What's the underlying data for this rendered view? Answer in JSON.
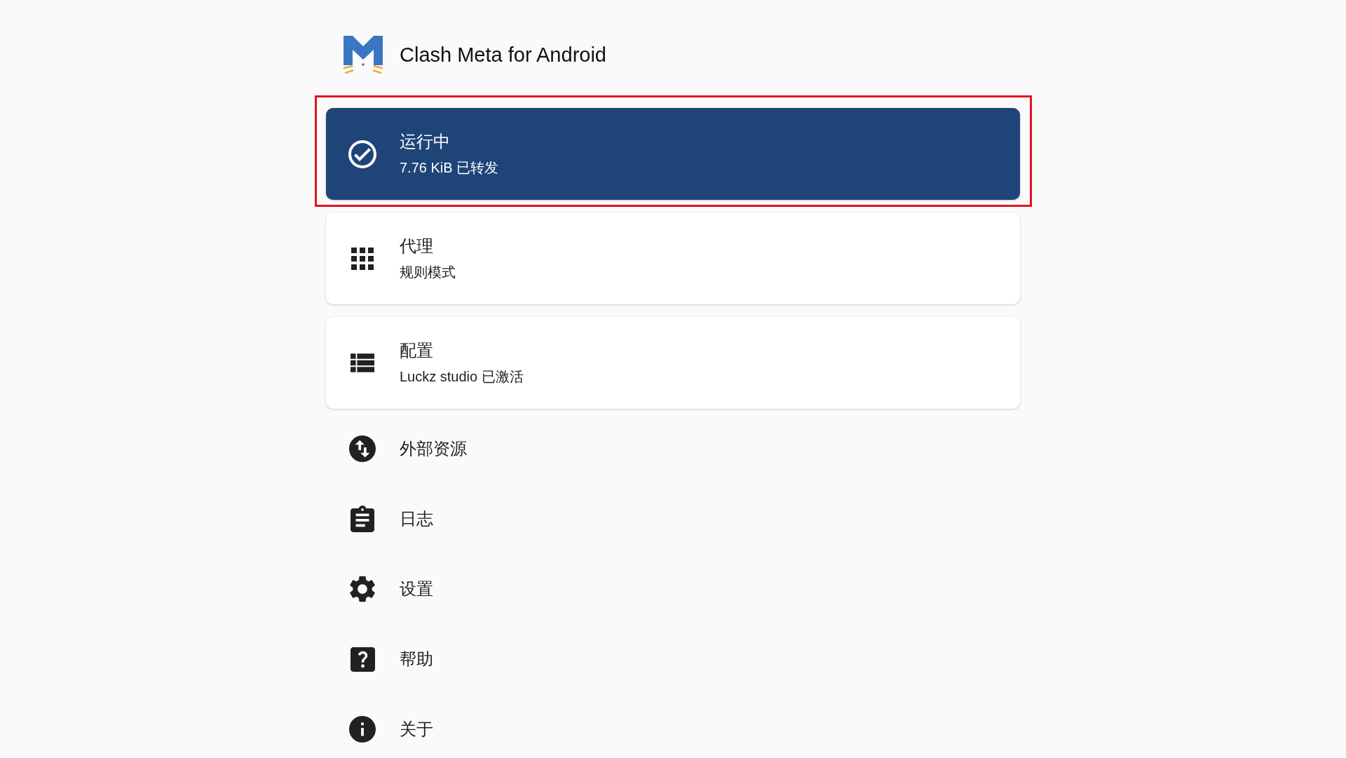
{
  "app_bar": {
    "title": "Clash Meta for Android"
  },
  "cards": [
    {
      "kind": "status",
      "title": "运行中",
      "subtitle": "7.76 KiB 已转发",
      "active": true,
      "highlighted": true
    },
    {
      "kind": "proxy",
      "title": "代理",
      "subtitle": "规则模式",
      "active": false,
      "highlighted": false
    },
    {
      "kind": "profile",
      "title": "配置",
      "subtitle": "Luckz studio 已激活",
      "active": false,
      "highlighted": false
    }
  ],
  "menu": [
    {
      "kind": "resources",
      "label": "外部资源"
    },
    {
      "kind": "logs",
      "label": "日志"
    },
    {
      "kind": "settings",
      "label": "设置"
    },
    {
      "kind": "help",
      "label": "帮助"
    },
    {
      "kind": "about",
      "label": "关于"
    }
  ]
}
